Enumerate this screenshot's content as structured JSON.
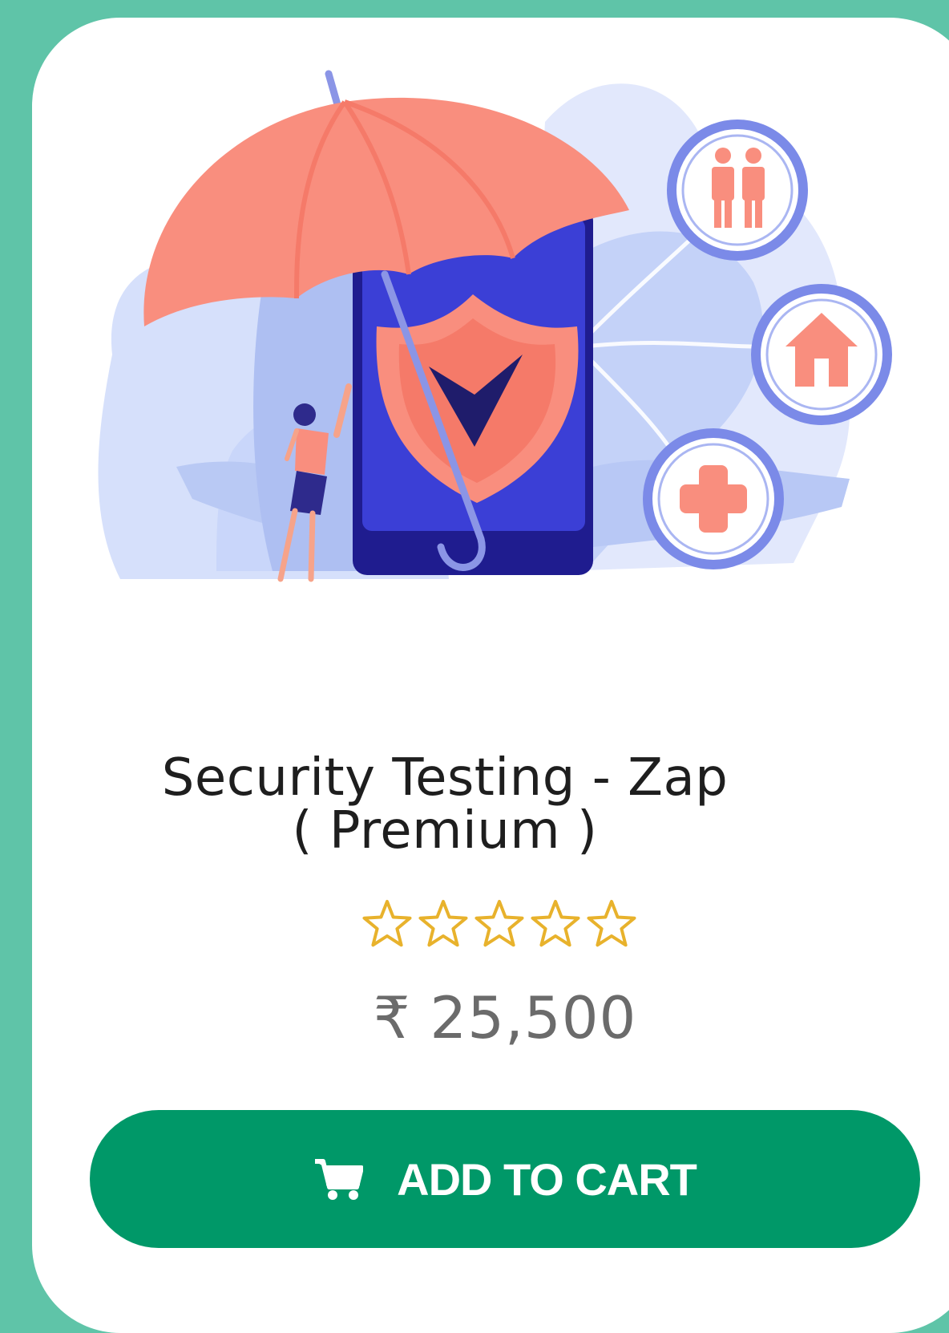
{
  "product": {
    "title_line1": "Security Testing - Zap",
    "title_line2": "( Premium )",
    "rating": 0,
    "rating_max": 5,
    "price": "₹ 25,500"
  },
  "cart_button": {
    "label": "ADD TO CART",
    "icon": "cart-icon"
  },
  "illustration": {
    "icons": [
      "umbrella-icon",
      "phone-shield-check-icon",
      "family-icon",
      "home-icon",
      "medical-cross-icon",
      "woman-figure"
    ]
  },
  "colors": {
    "page_background": "#5fc4a8",
    "card_background": "#ffffff",
    "button": "#009868",
    "button_text": "#ffffff",
    "star_outline": "#e8b22c",
    "price_text": "#6b6b6b",
    "umbrella": "#f98e7e",
    "phone": "#3b3fd6"
  }
}
